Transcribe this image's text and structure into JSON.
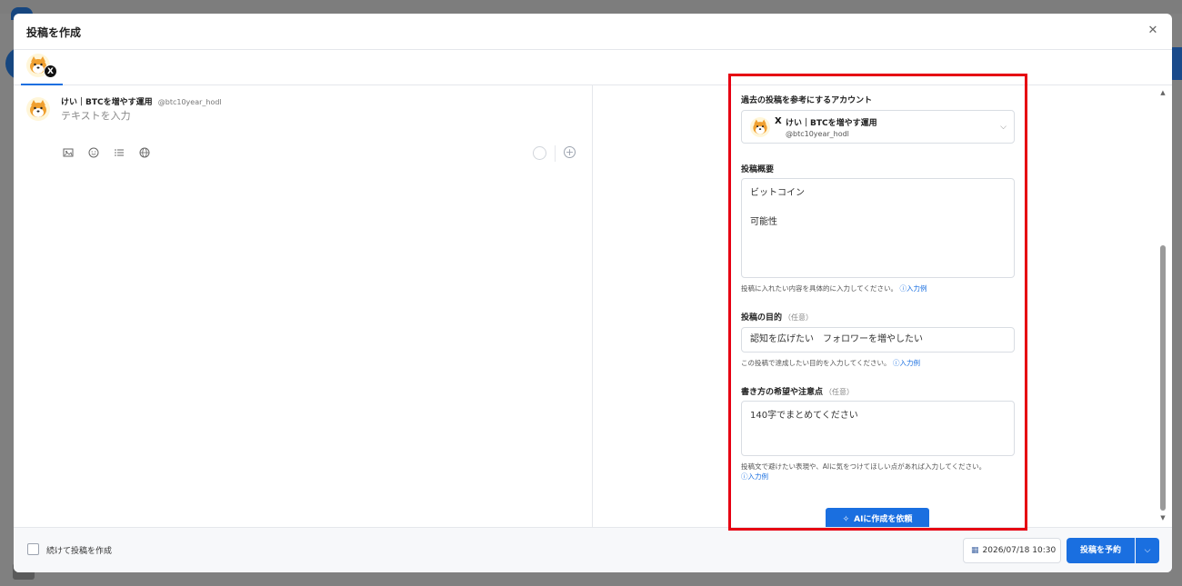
{
  "modal": {
    "title": "投稿を作成",
    "close_icon": "close-icon"
  },
  "account": {
    "name": "けい｜BTCを増やす運用",
    "handle": "@btc10year_hodl",
    "platform_badge": "X"
  },
  "compose": {
    "placeholder": "テキストを入力",
    "tools": [
      "image-icon",
      "emoji-icon",
      "list-icon",
      "globe-icon"
    ],
    "add_icon": "plus-icon"
  },
  "ai_panel": {
    "reference_label": "過去の投稿を参考にするアカウント",
    "reference_account": {
      "name": "けい｜BTCを増やす運用",
      "handle": "@btc10year_hodl"
    },
    "summary_label": "投稿概要",
    "summary_value": "ビットコイン\n\n可能性",
    "summary_help": "投稿に入れたい内容を具体的に入力してください。",
    "purpose_label": "投稿の目的",
    "purpose_optional": "（任意）",
    "purpose_value": "認知を広げたい　フォロワーを増やしたい",
    "purpose_help": "この投稿で達成したい目的を入力してください。",
    "notes_label": "書き方の希望や注意点",
    "notes_optional": "（任意）",
    "notes_value": "140字でまとめてください",
    "notes_help": "投稿文で避けたい表現や、AIに気をつけてほしい点があれば入力してください。",
    "example_link": "入力例",
    "generate_button": "AIに作成を依頼"
  },
  "footer": {
    "continue_label": "続けて投稿を作成",
    "datetime": "2026/07/18 10:30",
    "schedule_button": "投稿を予約"
  },
  "colors": {
    "accent": "#1a6fe0",
    "highlight": "#e60012"
  }
}
